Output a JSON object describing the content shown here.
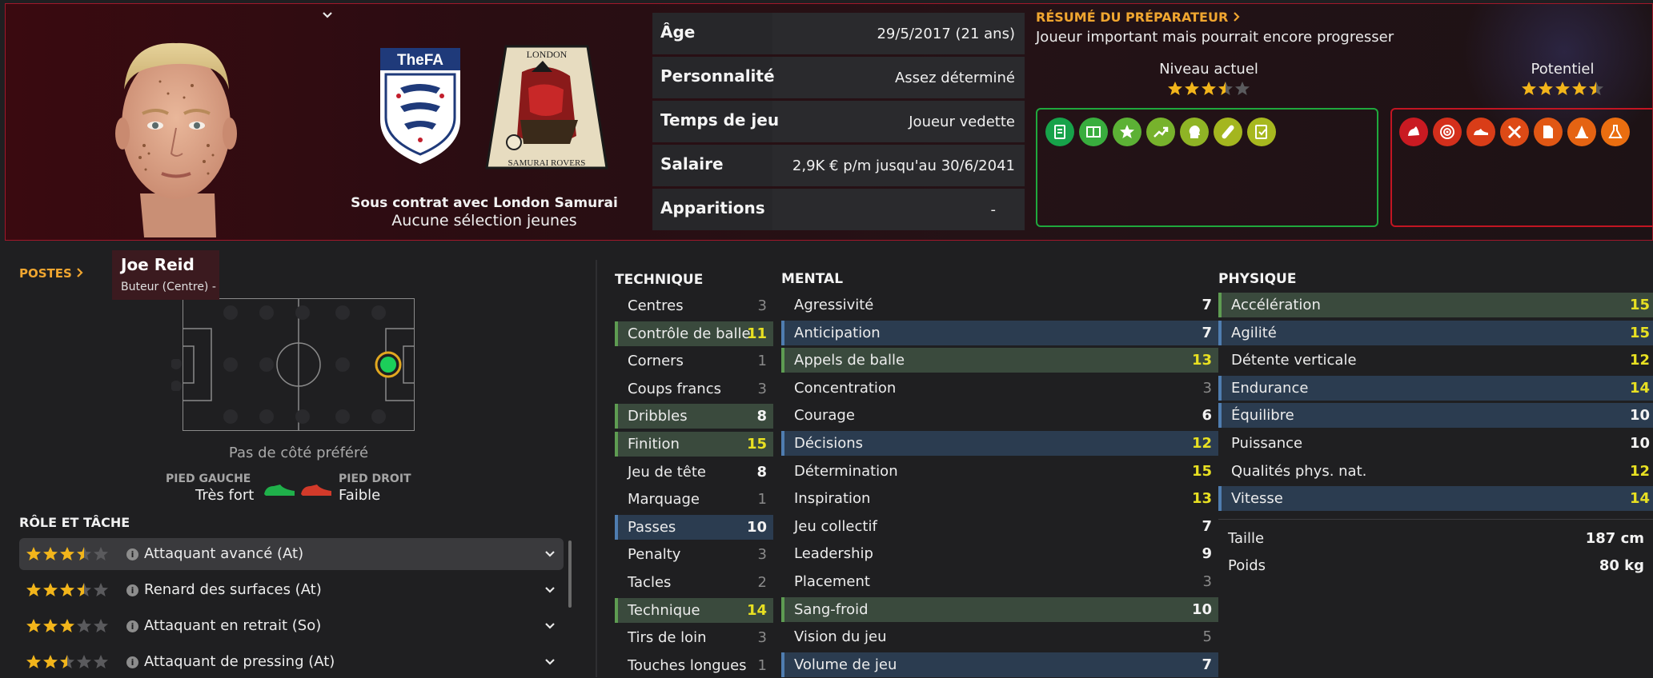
{
  "header": {
    "contract_line": "Sous contrat avec London Samurai",
    "youth_caps": "Aucune sélection jeunes",
    "club_badge_text_top": "LONDON",
    "club_badge_text_bottom": "SAMURAI ROVERS",
    "fa_badge_text": "TheFA"
  },
  "info": [
    {
      "label": "Âge",
      "value": "29/5/2017 (21 ans)"
    },
    {
      "label": "Personnalité",
      "value": "Assez déterminé"
    },
    {
      "label": "Temps de jeu",
      "value": "Joueur vedette"
    },
    {
      "label": "Salaire",
      "value": "2,9K € p/m jusqu'au 30/6/2041"
    },
    {
      "label": "Apparitions",
      "value": "-"
    }
  ],
  "coach": {
    "title": "RÉSUMÉ DU PRÉPARATEUR",
    "summary": "Joueur important mais pourrait encore progresser",
    "current_label": "Niveau actuel",
    "current_stars": 3.5,
    "potential_label": "Potentiel",
    "potential_stars": 4.5
  },
  "traits_green": [
    "document-icon",
    "pitch-icon",
    "star-icon",
    "trend-up-icon",
    "head-icon",
    "bandage-icon",
    "checklist-icon"
  ],
  "traits_red": [
    "foot-icon",
    "target-icon",
    "boots-icon",
    "cross-pens-icon",
    "paper-icon",
    "cone-icon",
    "flask-icon"
  ],
  "player": {
    "name": "Joe Reid",
    "position": "Buteur (Centre) -"
  },
  "positions_label": "POSTES",
  "no_side": "Pas de côté préféré",
  "feet": {
    "left_label": "PIED GAUCHE",
    "left_value": "Très fort",
    "right_label": "PIED DROIT",
    "right_value": "Faible"
  },
  "roles_title": "RÔLE ET TÂCHE",
  "roles": [
    {
      "label": "Attaquant avancé (At)",
      "stars": 3.5,
      "selected": true
    },
    {
      "label": "Renard des surfaces (At)",
      "stars": 3.5,
      "selected": false
    },
    {
      "label": "Attaquant en retrait (So)",
      "stars": 3,
      "selected": false
    },
    {
      "label": "Attaquant de pressing (At)",
      "stars": 2.5,
      "selected": false
    }
  ],
  "technique": {
    "title": "TECHNIQUE",
    "attrs": [
      {
        "name": "Centres",
        "value": "3",
        "hl": "plain",
        "c": "grey"
      },
      {
        "name": "Contrôle de balle",
        "value": "11",
        "hl": "green",
        "c": "yellow"
      },
      {
        "name": "Corners",
        "value": "1",
        "hl": "plain",
        "c": "grey"
      },
      {
        "name": "Coups francs",
        "value": "3",
        "hl": "plain",
        "c": "grey"
      },
      {
        "name": "Dribbles",
        "value": "8",
        "hl": "green",
        "c": "white"
      },
      {
        "name": "Finition",
        "value": "15",
        "hl": "green",
        "c": "yellow"
      },
      {
        "name": "Jeu de tête",
        "value": "8",
        "hl": "plain",
        "c": "white"
      },
      {
        "name": "Marquage",
        "value": "1",
        "hl": "plain",
        "c": "grey"
      },
      {
        "name": "Passes",
        "value": "10",
        "hl": "blue",
        "c": "white"
      },
      {
        "name": "Penalty",
        "value": "3",
        "hl": "plain",
        "c": "grey"
      },
      {
        "name": "Tacles",
        "value": "2",
        "hl": "plain",
        "c": "grey"
      },
      {
        "name": "Technique",
        "value": "14",
        "hl": "green",
        "c": "yellow"
      },
      {
        "name": "Tirs de loin",
        "value": "3",
        "hl": "plain",
        "c": "grey"
      },
      {
        "name": "Touches longues",
        "value": "1",
        "hl": "plain",
        "c": "grey"
      }
    ]
  },
  "mental": {
    "title": "MENTAL",
    "attrs": [
      {
        "name": "Agressivité",
        "value": "7",
        "hl": "plain",
        "c": "white"
      },
      {
        "name": "Anticipation",
        "value": "7",
        "hl": "blue",
        "c": "white"
      },
      {
        "name": "Appels de balle",
        "value": "13",
        "hl": "green",
        "c": "yellow"
      },
      {
        "name": "Concentration",
        "value": "3",
        "hl": "plain",
        "c": "grey"
      },
      {
        "name": "Courage",
        "value": "6",
        "hl": "plain",
        "c": "white"
      },
      {
        "name": "Décisions",
        "value": "12",
        "hl": "blue",
        "c": "yellow"
      },
      {
        "name": "Détermination",
        "value": "15",
        "hl": "plain",
        "c": "yellow"
      },
      {
        "name": "Inspiration",
        "value": "13",
        "hl": "plain",
        "c": "yellow"
      },
      {
        "name": "Jeu collectif",
        "value": "7",
        "hl": "plain",
        "c": "white"
      },
      {
        "name": "Leadership",
        "value": "9",
        "hl": "plain",
        "c": "white"
      },
      {
        "name": "Placement",
        "value": "3",
        "hl": "plain",
        "c": "grey"
      },
      {
        "name": "Sang-froid",
        "value": "10",
        "hl": "green",
        "c": "white"
      },
      {
        "name": "Vision du jeu",
        "value": "5",
        "hl": "plain",
        "c": "grey"
      },
      {
        "name": "Volume de jeu",
        "value": "7",
        "hl": "blue",
        "c": "white"
      }
    ]
  },
  "physique": {
    "title": "PHYSIQUE",
    "attrs": [
      {
        "name": "Accélération",
        "value": "15",
        "hl": "green",
        "c": "yellow"
      },
      {
        "name": "Agilité",
        "value": "15",
        "hl": "blue",
        "c": "yellow"
      },
      {
        "name": "Détente verticale",
        "value": "12",
        "hl": "plain",
        "c": "yellow"
      },
      {
        "name": "Endurance",
        "value": "14",
        "hl": "blue",
        "c": "yellow"
      },
      {
        "name": "Équilibre",
        "value": "10",
        "hl": "blue",
        "c": "white"
      },
      {
        "name": "Puissance",
        "value": "10",
        "hl": "plain",
        "c": "white"
      },
      {
        "name": "Qualités phys. nat.",
        "value": "12",
        "hl": "plain",
        "c": "yellow"
      },
      {
        "name": "Vitesse",
        "value": "14",
        "hl": "blue",
        "c": "yellow"
      }
    ],
    "height_label": "Taille",
    "height_value": "187 cm",
    "weight_label": "Poids",
    "weight_value": "80 kg"
  }
}
